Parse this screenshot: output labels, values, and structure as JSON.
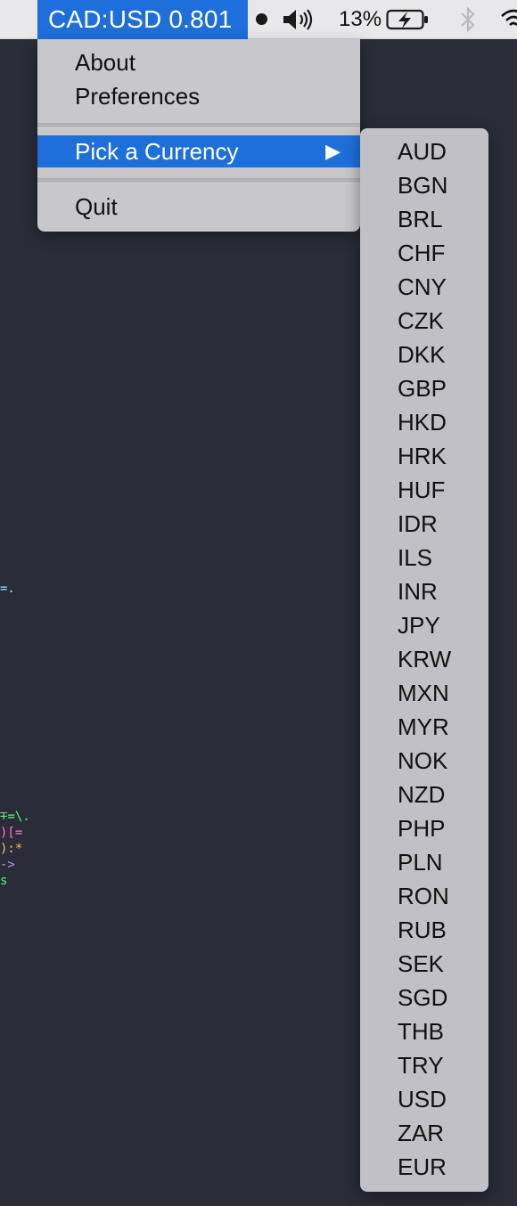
{
  "menubar": {
    "status_title": "CAD:USD 0.801",
    "battery_percent": "13%",
    "icons": [
      "record-dot-icon",
      "volume-icon",
      "battery-charging-icon",
      "bluetooth-icon",
      "wifi-icon"
    ]
  },
  "menu": {
    "about_label": "About",
    "preferences_label": "Preferences",
    "pick_currency_label": "Pick a Currency",
    "submenu_arrow": "▶",
    "quit_label": "Quit"
  },
  "currencies": [
    "AUD",
    "BGN",
    "BRL",
    "CHF",
    "CNY",
    "CZK",
    "DKK",
    "GBP",
    "HKD",
    "HRK",
    "HUF",
    "IDR",
    "ILS",
    "INR",
    "JPY",
    "KRW",
    "MXN",
    "MYR",
    "NOK",
    "NZD",
    "PHP",
    "PLN",
    "RON",
    "RUB",
    "SEK",
    "SGD",
    "THB",
    "TRY",
    "USD",
    "ZAR",
    "EUR"
  ],
  "background_code": {
    "line1": "=.",
    "line2": "_",
    "line3": "+=\\.",
    "line4": ")[=",
    "line5": "):*",
    "line6": "->",
    "line7": "s"
  },
  "colors": {
    "accent": "#1e6fd9",
    "menu_bg": "#c7c7cc",
    "desktop_bg": "#2a2c37"
  }
}
